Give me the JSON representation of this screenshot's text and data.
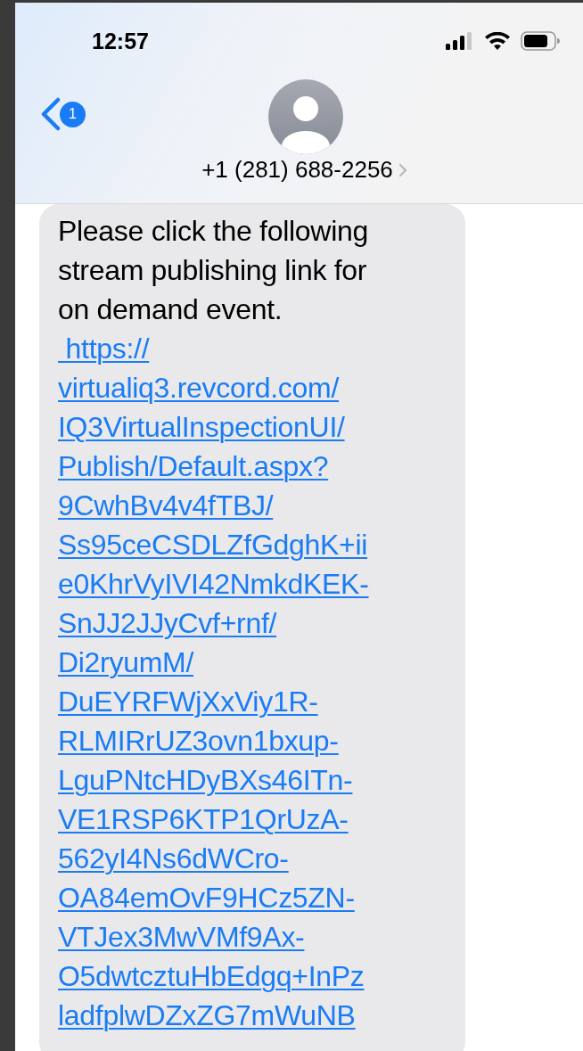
{
  "status_bar": {
    "time": "12:57"
  },
  "header": {
    "back_badge": "1",
    "contact": "+1 (281) 688-2256"
  },
  "message": {
    "text_lines": [
      "Please click the following",
      "stream publishing link for",
      "on demand event."
    ],
    "link_lines": [
      " https://",
      "virtualiq3.revcord.com/",
      "IQ3VirtualInspectionUI/",
      "Publish/Default.aspx?",
      "9CwhBv4v4fTBJ/",
      "Ss95ceCSDLZfGdghK+ii",
      "e0KhrVyIVI42NmkdKEK-",
      "SnJJ2JJyCvf+rnf/",
      "Di2ryumM/",
      "DuEYRFWjXxViy1R-",
      "RLMIRrUZ3ovn1bxup-",
      "LguPNtcHDyBXs46ITn-",
      "VE1RSP6KTP1QrUzA-",
      "562yI4Ns6dWCro-",
      "OA84emOvF9HCz5ZN-",
      "VTJex3MwVMf9Ax-",
      "O5dwtcztuHbEdgq+InPz",
      "ladfplwDZxZG7mWuNB"
    ]
  }
}
